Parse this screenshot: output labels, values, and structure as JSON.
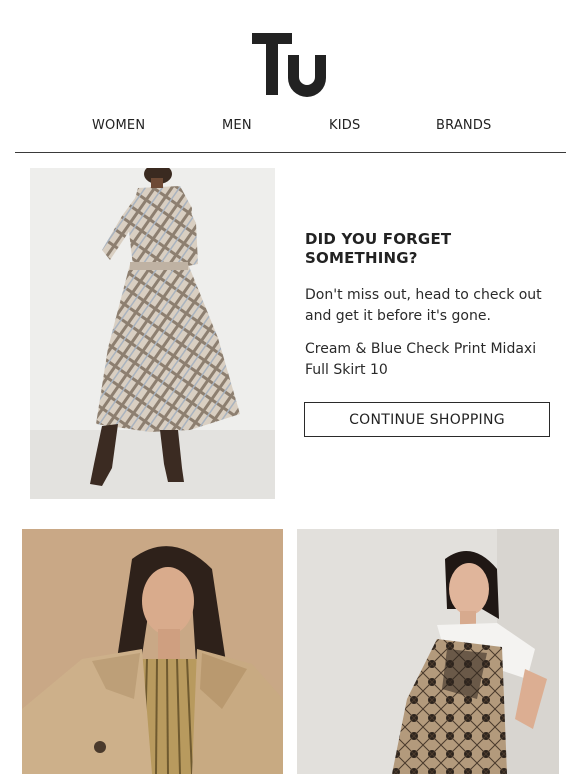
{
  "brand": {
    "logo_text": "Tu"
  },
  "nav": {
    "items": [
      {
        "label": "WOMEN"
      },
      {
        "label": "MEN"
      },
      {
        "label": "KIDS"
      },
      {
        "label": "BRANDS"
      }
    ]
  },
  "promo": {
    "heading_line1": "DID YOU FORGET",
    "heading_line2": "SOMETHING?",
    "body_line1": "Don't miss out, head to check out",
    "body_line2": "and get it before it's gone.",
    "product_line1": "Cream & Blue Check Print Midaxi",
    "product_line2": "Full Skirt 10",
    "cta_label": "CONTINUE SHOPPING"
  },
  "colors": {
    "text": "#222222",
    "hero_bg": "#eeeeec",
    "tile_left_bg": "#c9a886",
    "tile_right_bg": "#e2e0dc"
  }
}
